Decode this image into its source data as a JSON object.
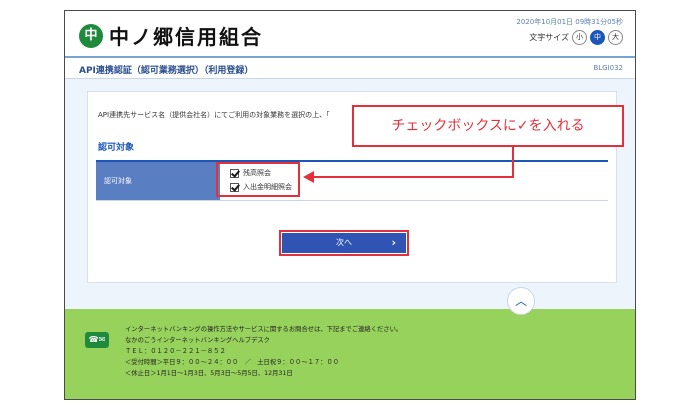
{
  "header": {
    "logo_mark": "中",
    "logo_text": "中ノ郷信用組合",
    "datetime": "2020年10月01日 09時31分05秒",
    "font_size_label": "文字サイズ",
    "font_sizes": [
      "小",
      "中",
      "大"
    ]
  },
  "page": {
    "title": "API連携認証（認可業務選択）（利用登録）",
    "screen_code": "BLGI032"
  },
  "main": {
    "intro": "API連携先サービス名（提供会社名）にてご利用の対象業務を選択の上、「",
    "section_title": "認可対象",
    "row_label": "認可対象",
    "options": [
      {
        "label": "残高照会",
        "checked": true
      },
      {
        "label": "入出金明細照会",
        "checked": true
      }
    ],
    "next_button": "次へ"
  },
  "callout": {
    "text": "チェックボックスに✓を入れる"
  },
  "footer": {
    "lines": [
      "インターネットバンキングの操作方法やサービスに関するお問合せは、下記までご連絡ください。",
      "なかのごうインターネットバンキングヘルプデスク",
      "ＴＥＬ：０１２０－２２１－８５２",
      "＜受付時間＞平日９：００～２４：００　／　土日祝９：００～１７：００",
      "＜休止日＞1月1日～1月3日、5月3日～5月5日、12月31日"
    ],
    "icon": "phone-mail-icon",
    "back_to_top_icon": "chevron-up-icon"
  },
  "colors": {
    "accent": "#1b56b8",
    "annotation": "#e3303a",
    "footer_bg": "#97d25c",
    "brand_green": "#1f8a3c"
  }
}
